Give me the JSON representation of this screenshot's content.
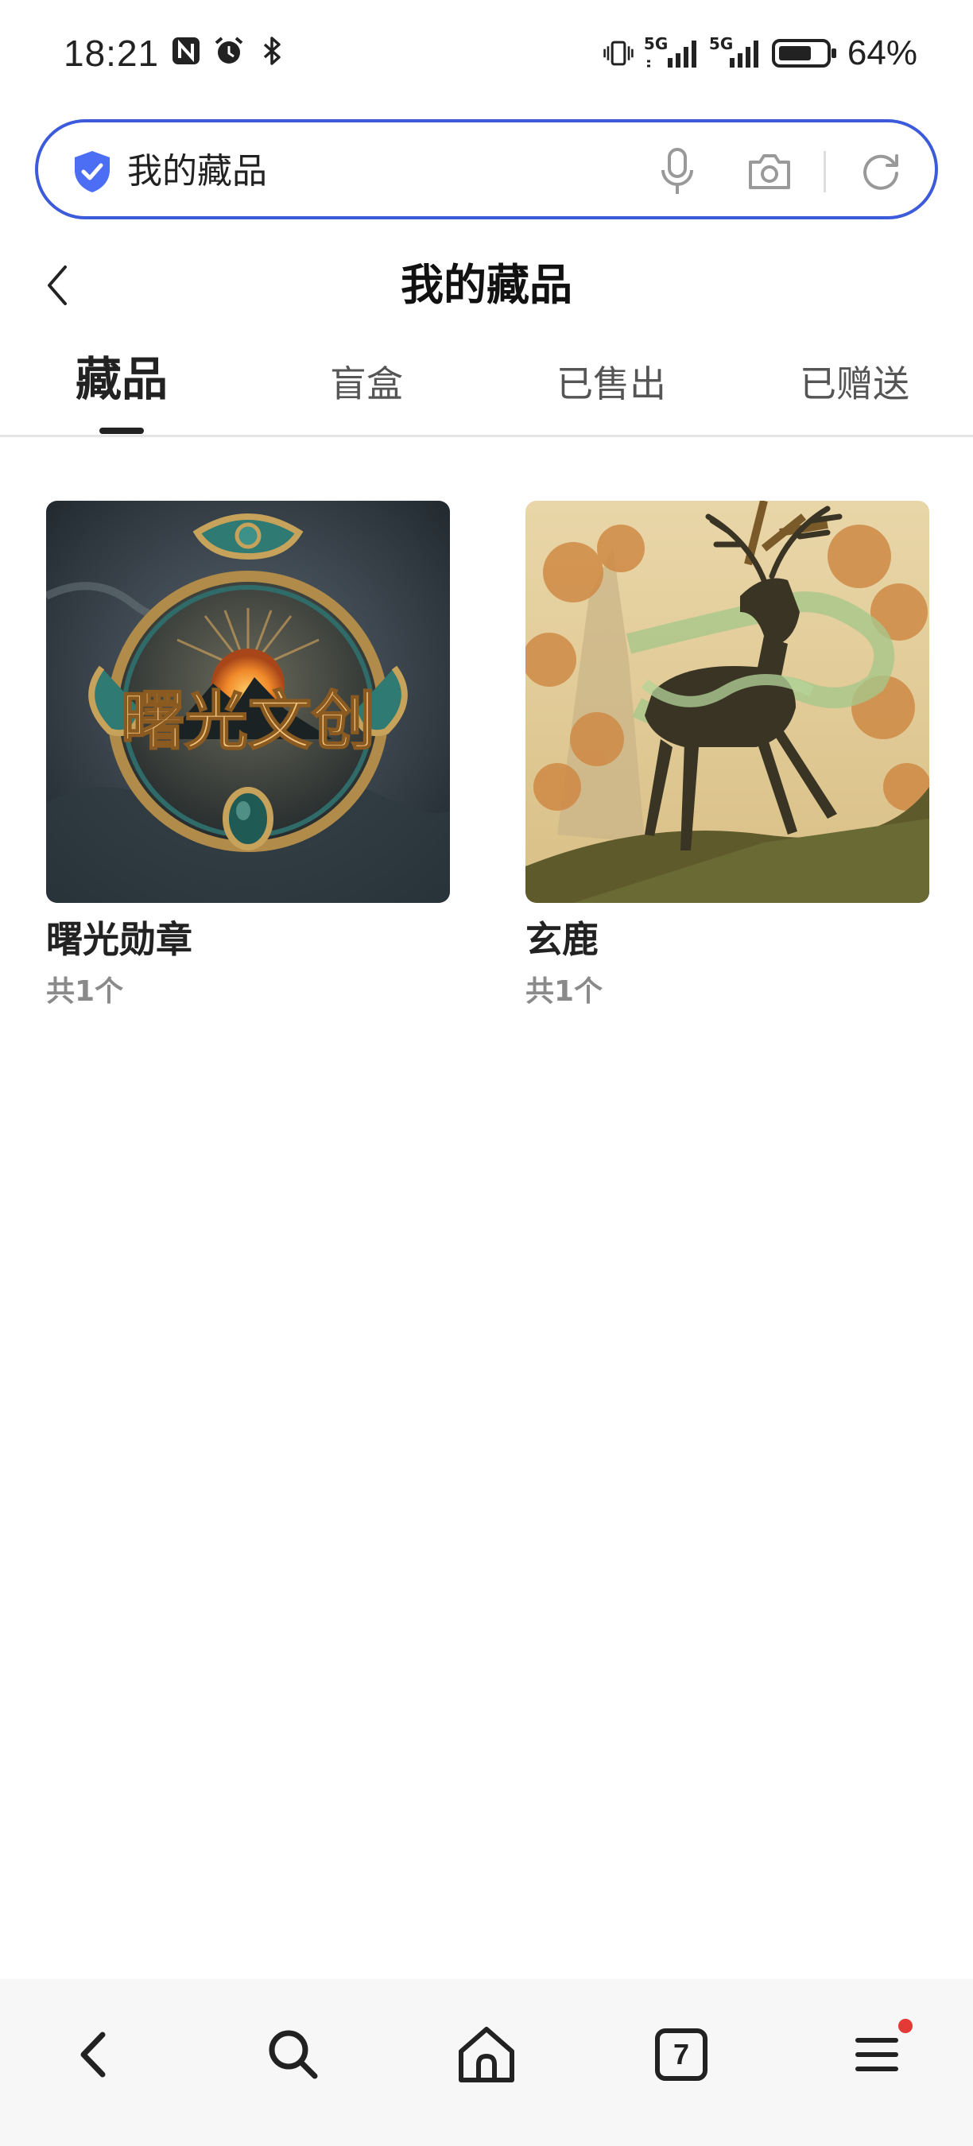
{
  "status_bar": {
    "time": "18:21",
    "battery": "64%",
    "icons": [
      "nfc-icon",
      "alarm-icon",
      "bluetooth-icon",
      "vibrate-icon",
      "signal-5g-icon",
      "signal-5g-icon",
      "battery-icon"
    ],
    "network_labels": [
      "5G",
      "5G"
    ]
  },
  "search": {
    "query": "我的藏品",
    "icons": [
      "shield-icon",
      "mic-icon",
      "camera-icon",
      "refresh-icon"
    ],
    "accent_color": "#3b5bdb"
  },
  "header": {
    "title": "我的藏品"
  },
  "tabs": [
    {
      "label": "藏品",
      "active": true
    },
    {
      "label": "盲盒",
      "active": false
    },
    {
      "label": "已售出",
      "active": false
    },
    {
      "label": "已赠送",
      "active": false
    }
  ],
  "collection": [
    {
      "name": "曙光勋章",
      "count": "共1个",
      "image_text": "曙光文创"
    },
    {
      "name": "玄鹿",
      "count": "共1个"
    }
  ],
  "bottom_nav": {
    "tab_count": "7",
    "icons": [
      "back-icon",
      "search-icon",
      "home-icon",
      "tabs-icon",
      "menu-icon"
    ]
  }
}
